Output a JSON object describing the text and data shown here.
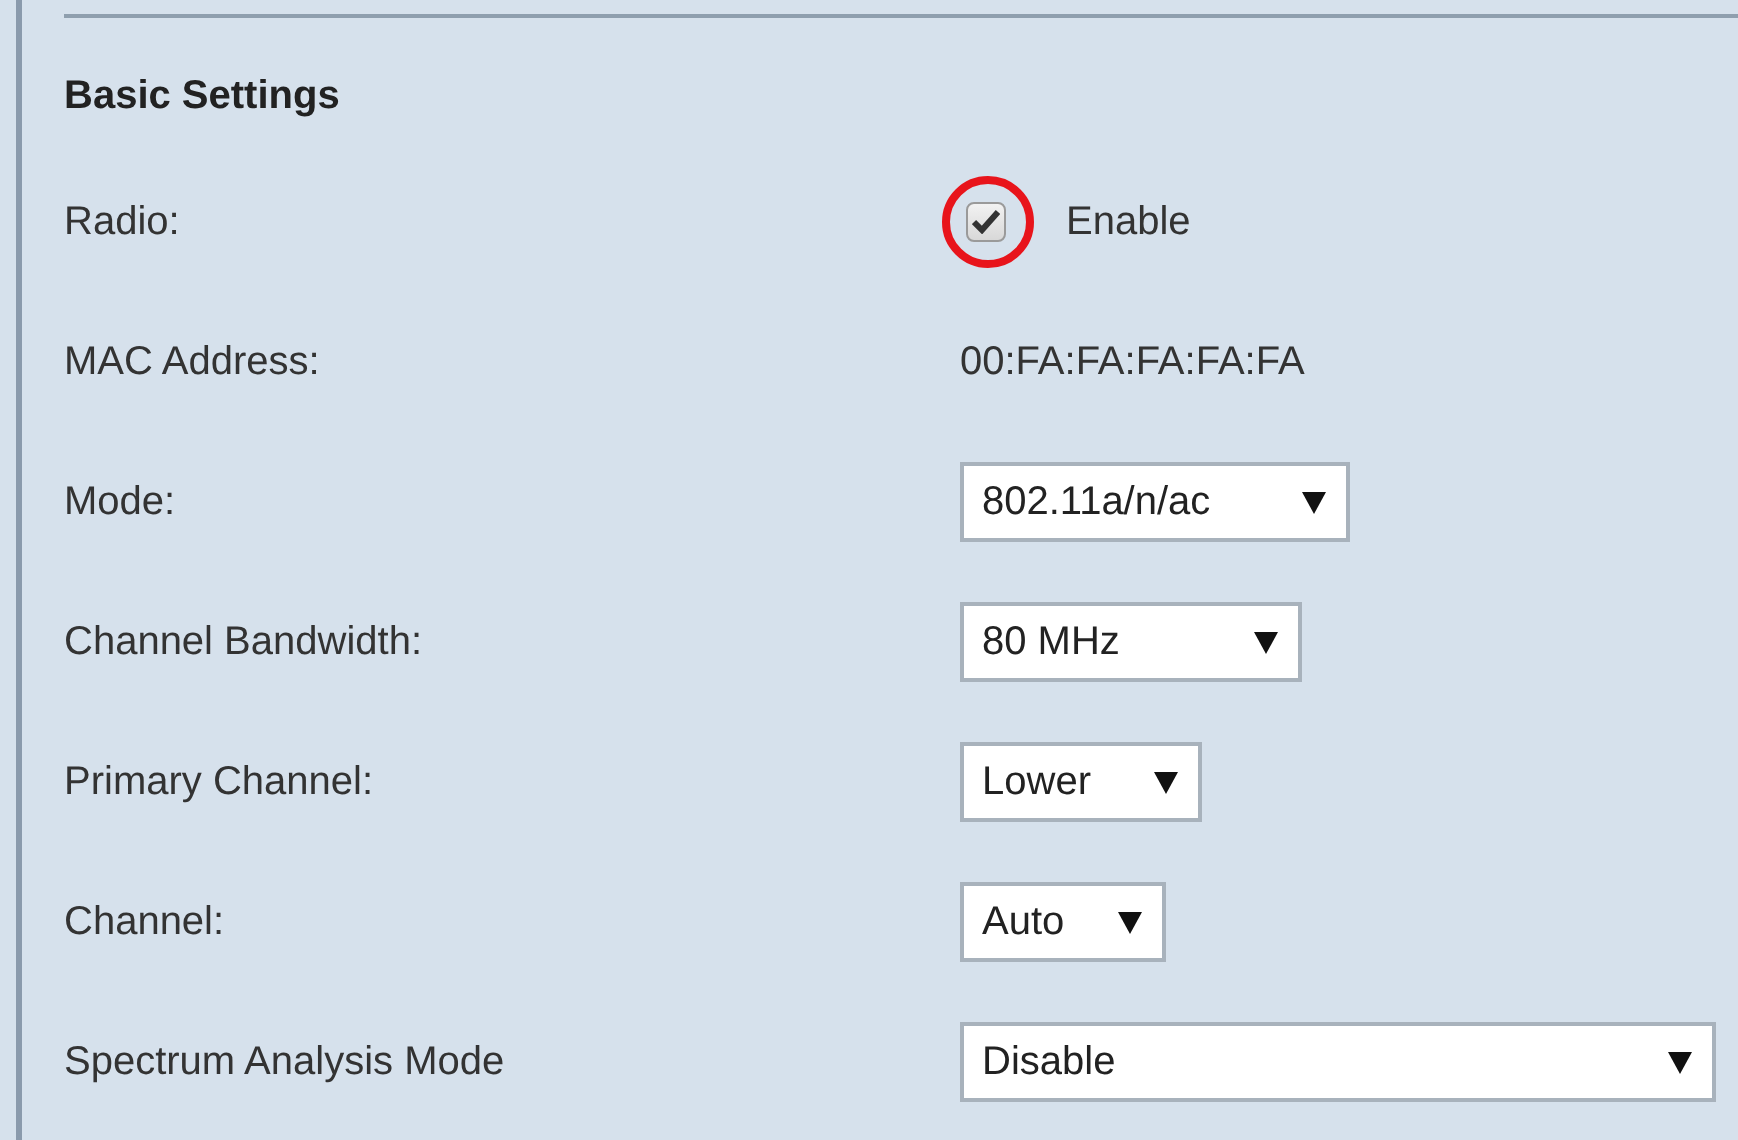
{
  "section": {
    "title": "Basic Settings"
  },
  "rows": [
    {
      "kind": "checkbox",
      "label": "Radio:",
      "checked": true,
      "text": "Enable",
      "highlighted": true
    },
    {
      "kind": "text",
      "label": "MAC Address:",
      "value": "00:FA:FA:FA:FA:FA"
    },
    {
      "kind": "select",
      "label": "Mode:",
      "value": "802.11a/n/ac"
    },
    {
      "kind": "select",
      "label": "Channel Bandwidth:",
      "value": "80 MHz"
    },
    {
      "kind": "select",
      "label": "Primary Channel:",
      "value": "Lower"
    },
    {
      "kind": "select",
      "label": "Channel:",
      "value": "Auto"
    },
    {
      "kind": "select",
      "label": "Spectrum Analysis Mode",
      "value": "Disable"
    }
  ]
}
